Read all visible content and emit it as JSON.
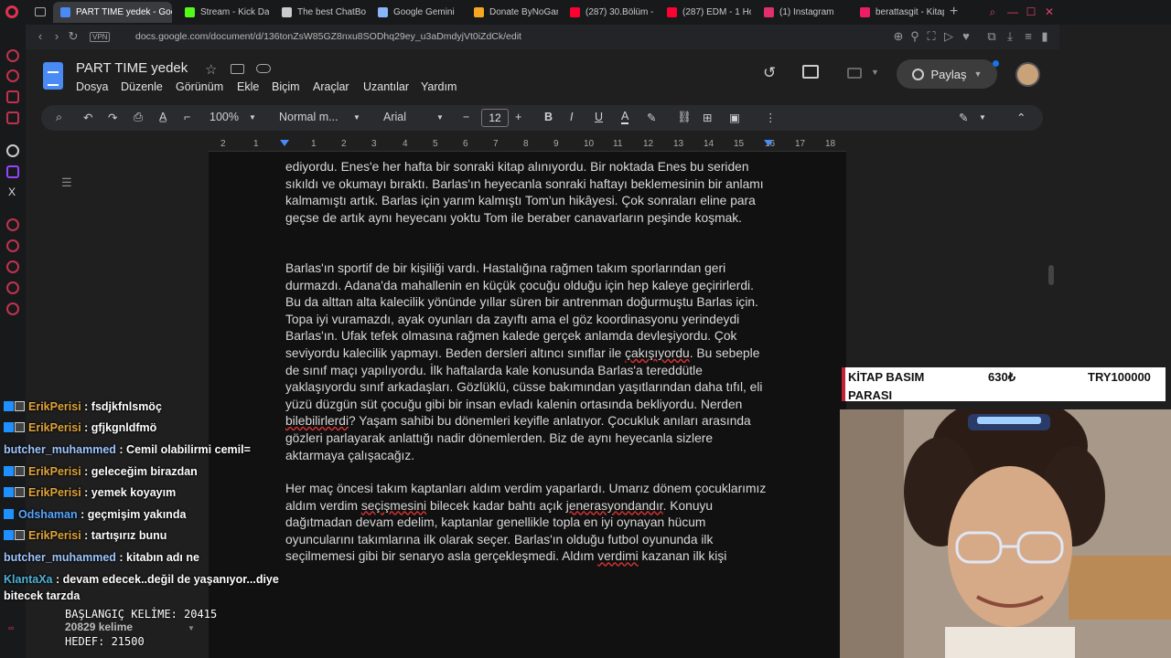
{
  "tabs": [
    {
      "label": "PART TIME yedek - Goog",
      "active": true,
      "color": "#4a8af4"
    },
    {
      "label": "Stream - Kick Das",
      "active": false,
      "color": "#53fc18"
    },
    {
      "label": "The best ChatBot",
      "active": false,
      "color": "#cccccc"
    },
    {
      "label": "Google Gemini",
      "active": false,
      "color": "#8ab4f8"
    },
    {
      "label": "Donate ByNoGam",
      "active": false,
      "color": "#f5a623"
    },
    {
      "label": "(287) 30.Bölüm -",
      "active": false,
      "color": "#ff0033"
    },
    {
      "label": "(287) EDM - 1 Hou",
      "active": false,
      "color": "#ff0033"
    },
    {
      "label": "(1) Instagram",
      "active": false,
      "color": "#e1306c"
    },
    {
      "label": "berattasgit - Kitap",
      "active": false,
      "color": "#e91e63"
    }
  ],
  "address": {
    "vpn": "VPN",
    "url": "docs.google.com/document/d/136tonZsW85GZ8nxu8SODhq29ey_u3aDmdyjVt0iZdCk/edit"
  },
  "docs": {
    "title": "PART TIME  yedek",
    "menus": [
      "Dosya",
      "Düzenle",
      "Görünüm",
      "Ekle",
      "Biçim",
      "Araçlar",
      "Uzantılar",
      "Yardım"
    ],
    "share_label": "Paylaş",
    "toolbar": {
      "zoom": "100%",
      "style": "Normal m...",
      "font": "Arial",
      "size": "12"
    },
    "ruler_ticks": [
      "2",
      "1",
      "1",
      "2",
      "3",
      "4",
      "5",
      "6",
      "7",
      "8",
      "9",
      "10",
      "11",
      "12",
      "13",
      "14",
      "15",
      "16",
      "17",
      "18"
    ]
  },
  "document": {
    "p1": "ediyordu. Enes'e her hafta bir sonraki kitap alınıyordu. Bir noktada Enes bu seriden sıkıldı ve okumayı bıraktı. Barlas'ın heyecanla sonraki haftayı beklemesinin bir anlamı kalmamıştı artık. Barlas için yarım kalmıştı Tom'un hikâyesi. Çok sonraları eline para geçse de artık aynı heyecanı yoktu Tom ile beraber canavarların peşinde koşmak.",
    "p2a": "Barlas'ın sportif de bir kişiliği vardı. Hastalığına rağmen takım sporlarından geri durmazdı. Adana'da mahallenin en küçük çocuğu olduğu için hep kaleye geçirirlerdi. Bu da alttan alta kalecilik yönünde yıllar süren bir antrenman doğurmuştu Barlas için. Topa iyi vuramazdı, ayak oyunları da zayıftı ama el göz koordinasyonu yerindeydi Barlas'ın. Ufak tefek olmasına rağmen kalede gerçek anlamda devleşiyordu. Çok seviyordu kalecilik yapmayı. Beden dersleri altıncı sınıflar ile ",
    "p2err1": "çakışıyordu",
    "p2b": ". Bu sebeple de sınıf maçı yapılıyordu. İlk haftalarda kale konusunda Barlas'a tereddütle yaklaşıyordu sınıf arkadaşları. Gözlüklü, cüsse bakımından yaşıtlarından daha tıfıl, eli yüzü düzgün süt çocuğu gibi bir insan evladı kalenin ortasında bekliyordu. Nerden ",
    "p2err2": "bilebilirlerdi",
    "p2c": "? Yaşam sahibi bu dönemleri keyifle anlatıyor. Çocukluk anıları arasında gözleri parlayarak anlattığı nadir dönemlerden. Biz de aynı heyecanla sizlere aktarmaya çalışacağız.",
    "p3a": "Her maç öncesi takım kaptanları aldım verdim yaparlardı. Umarız dönem çocuklarımız aldım verdim ",
    "p3err1": "seçişmesini",
    "p3b": " bilecek kadar bahtı açık ",
    "p3err2": "jenerasyondandır",
    "p3c": ". Konuyu dağıtmadan devam edelim, kaptanlar genellikle topla en iyi oynayan hücum oyuncularını takımlarına ilk olarak seçer. Barlas'ın olduğu futbol oyununda ilk seçilmemesi gibi bir senaryo asla gerçekleşmedi. Aldım ",
    "p3err3": "verdimi",
    "p3d": " kazanan ilk kişi"
  },
  "chat": [
    {
      "user": "ErikPerisi",
      "msg": " : fsdjkfnlsmöç",
      "badges": true,
      "cls": "u-erik"
    },
    {
      "user": "ErikPerisi",
      "msg": " : gfjkgnldfmö",
      "badges": true,
      "cls": "u-erik"
    },
    {
      "user": "butcher_muhammed",
      "msg": " : Cemil olabilirmi cemil=",
      "badges": false,
      "cls": "u-butcher"
    },
    {
      "user": "ErikPerisi",
      "msg": " : geleceğim birazdan",
      "badges": true,
      "cls": "u-erik"
    },
    {
      "user": "ErikPerisi",
      "msg": " : yemek koyayım",
      "badges": true,
      "cls": "u-erik"
    },
    {
      "user": "Odshaman",
      "msg": " : geçmişim yakında",
      "badges": "one",
      "cls": "u-ods"
    },
    {
      "user": "ErikPerisi",
      "msg": " : tartışırız bunu",
      "badges": true,
      "cls": "u-erik"
    },
    {
      "user": "butcher_muhammed",
      "msg": " : kitabın adı ne",
      "badges": false,
      "cls": "u-butcher"
    },
    {
      "user": "KlantaXa",
      "msg": " : devam edecek..değil de yaşanıyor...diye",
      "badges": false,
      "cls": "u-klant"
    }
  ],
  "chat_wrap": "bitecek tarzda",
  "counter": {
    "start": "BAŞLANGIÇ KELİME: 20415",
    "words": "20829 kelime",
    "goal": "HEDEF: 21500"
  },
  "pricebox": {
    "label": "KİTAP BASIM PARASI",
    "price": "630₺",
    "goal": "TRY100000"
  }
}
